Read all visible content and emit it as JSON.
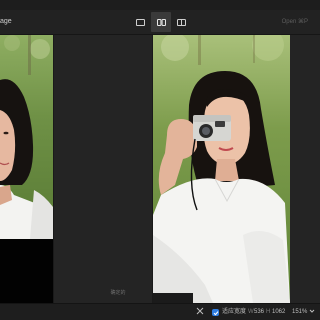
{
  "toolbar": {
    "title": "age",
    "right_hint": "Open ⌘P",
    "view_modes": [
      "single-view",
      "split-view",
      "compare-view"
    ],
    "active_view": "split-view"
  },
  "canvas": {
    "center_label": "确定的"
  },
  "status": {
    "fit_label": "适应宽度",
    "width_label": "W",
    "width_value": "536",
    "height_label": "H",
    "height_value": "1062",
    "zoom": "151%",
    "fit_checked": true
  },
  "colors": {
    "background": "#242424",
    "toolbar": "#222222",
    "accent": "#2f7de1"
  },
  "icons": {
    "crop_icon": "crop-icon",
    "check_icon": "check-icon",
    "chevron_down_icon": "chevron-down-icon"
  }
}
